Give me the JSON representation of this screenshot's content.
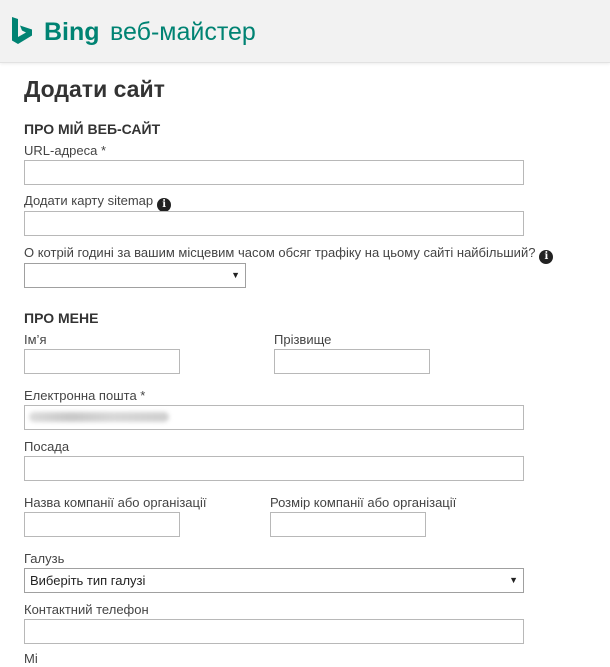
{
  "header": {
    "brand": "Bing",
    "product": "веб-майстер",
    "brand_color": "#008373"
  },
  "page": {
    "title": "Додати сайт"
  },
  "about_site": {
    "section_title": "ПРО МІЙ ВЕБ-САЙТ",
    "url_label": "URL-адреса *",
    "url_value": "",
    "sitemap_label": "Додати карту sitemap",
    "traffic_label": "О котрій годині за вашим місцевим часом обсяг трафіку на цьому сайті найбільший?",
    "traffic_value": ""
  },
  "about_me": {
    "section_title": "ПРО МЕНЕ",
    "first_name_label": "Ім’я",
    "last_name_label": "Прізвище",
    "email_label": "Електронна пошта *",
    "position_label": "Посада",
    "company_name_label": "Назва компанії або організації",
    "company_size_label": "Розмір компанії або організації",
    "industry_label": "Галузь",
    "industry_value": "Виберіть тип галузі",
    "phone_label": "Контактний телефон",
    "next_label_partial": "Мі"
  },
  "icons": {
    "info": "info-icon",
    "dropdown": "chevron-down-icon",
    "logo": "bing-logo-icon"
  }
}
